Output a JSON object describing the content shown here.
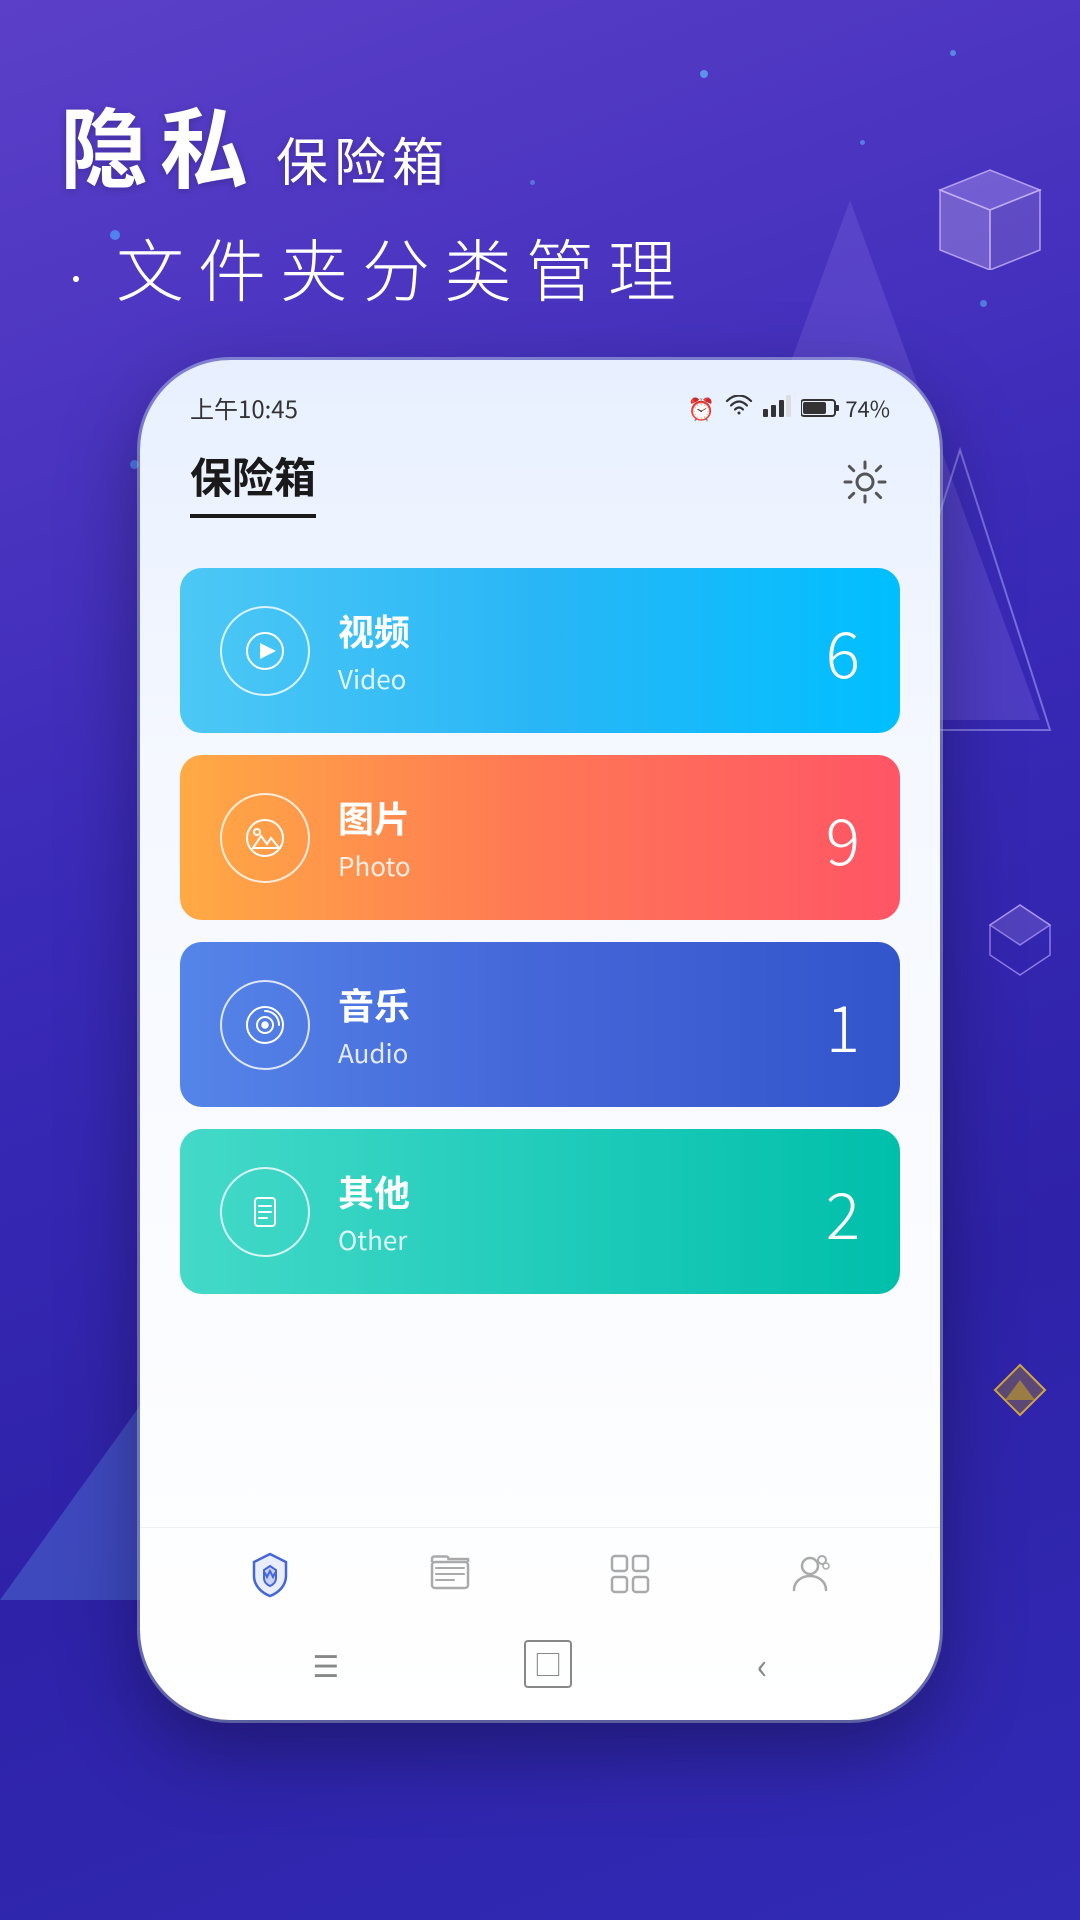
{
  "background": {
    "gradient_start": "#5b3fc8",
    "gradient_end": "#2e22a8"
  },
  "header": {
    "line1_big": "隐私",
    "line1_small": "保险箱",
    "line2": "文件夹分类管理"
  },
  "status_bar": {
    "time": "上午10:45",
    "battery": "74%"
  },
  "app_title": "保险箱",
  "settings_label": "设置",
  "categories": [
    {
      "id": "video",
      "name_cn": "视频",
      "name_en": "Video",
      "count": "6",
      "icon": "play"
    },
    {
      "id": "photo",
      "name_cn": "图片",
      "name_en": "Photo",
      "count": "9",
      "icon": "photo"
    },
    {
      "id": "audio",
      "name_cn": "音乐",
      "name_en": "Audio",
      "count": "1",
      "icon": "music"
    },
    {
      "id": "other",
      "name_cn": "其他",
      "name_en": "Other",
      "count": "2",
      "icon": "file"
    }
  ],
  "bottom_nav": [
    {
      "id": "safe",
      "label": "保险箱",
      "active": true
    },
    {
      "id": "files",
      "label": "文件",
      "active": false
    },
    {
      "id": "apps",
      "label": "应用",
      "active": false
    },
    {
      "id": "account",
      "label": "账户",
      "active": false
    }
  ],
  "android_nav": {
    "menu": "☰",
    "home": "□",
    "back": "‹"
  }
}
